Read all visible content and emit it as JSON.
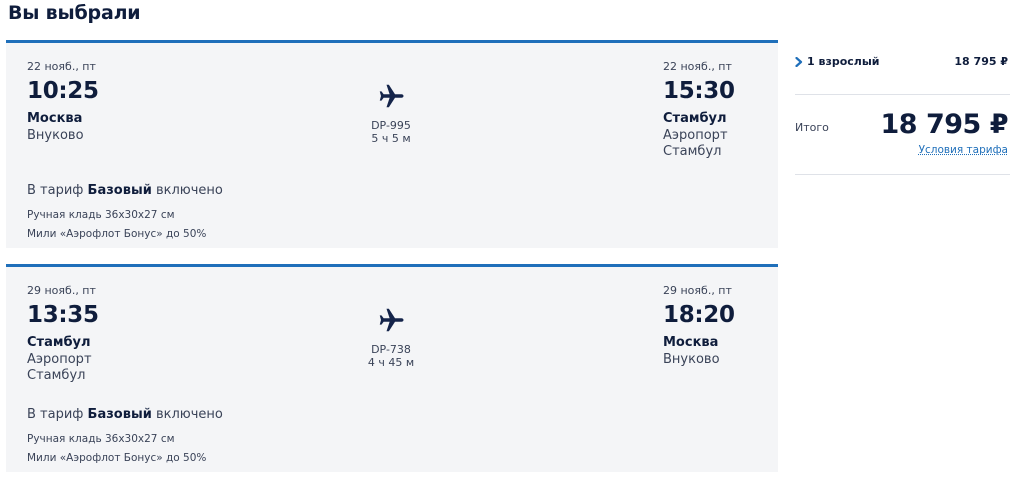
{
  "page": {
    "title": "Вы выбрали"
  },
  "colors": {
    "accent": "#1f6fba",
    "card_bg": "#f4f5f7",
    "text_dark": "#0f1d3c"
  },
  "flights": [
    {
      "departure": {
        "date": "22 нояб., пт",
        "time": "10:25",
        "city": "Москва",
        "airport": "Внуково"
      },
      "arrival": {
        "date": "22 нояб., пт",
        "time": "15:30",
        "city": "Стамбул",
        "airport": "Аэропорт Стамбул"
      },
      "flight_number": "DP-995",
      "duration": "5 ч 5 м",
      "tariff": {
        "prefix": "В тариф",
        "name": "Базовый",
        "suffix": "включено"
      },
      "perks": [
        "Ручная кладь 36x30x27 см",
        "Мили «Аэрофлот Бонус» до 50%"
      ]
    },
    {
      "departure": {
        "date": "29 нояб., пт",
        "time": "13:35",
        "city": "Стамбул",
        "airport": "Аэропорт Стамбул"
      },
      "arrival": {
        "date": "29 нояб., пт",
        "time": "18:20",
        "city": "Москва",
        "airport": "Внуково"
      },
      "flight_number": "DP-738",
      "duration": "4 ч 45 м",
      "tariff": {
        "prefix": "В тариф",
        "name": "Базовый",
        "suffix": "включено"
      },
      "perks": [
        "Ручная кладь 36x30x27 см",
        "Мили «Аэрофлот Бонус» до 50%"
      ]
    }
  ],
  "summary": {
    "passengers_label": "1 взрослый",
    "passengers_price": "18 795 ₽",
    "total_label": "Итого",
    "total_price": "18 795 ₽",
    "fare_terms_link": "Условия тарифа"
  },
  "icons": {
    "plane": "plane-icon",
    "chevron": "chevron-right-icon"
  }
}
